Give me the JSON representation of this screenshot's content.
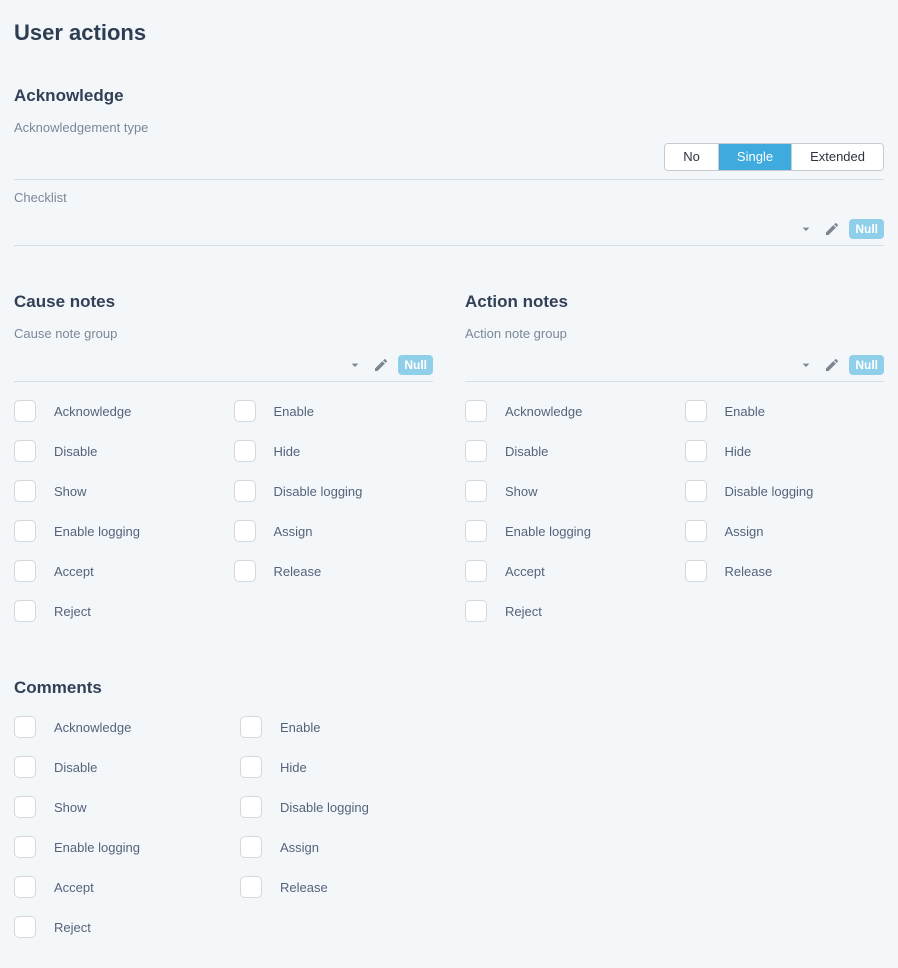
{
  "page_title": "User actions",
  "acknowledge": {
    "title": "Acknowledge",
    "type_label": "Acknowledgement type",
    "options": {
      "no": "No",
      "single": "Single",
      "extended": "Extended"
    },
    "selected": "single",
    "checklist_label": "Checklist",
    "null_badge": "Null"
  },
  "cause": {
    "title": "Cause notes",
    "group_label": "Cause note group",
    "null_badge": "Null"
  },
  "action": {
    "title": "Action notes",
    "group_label": "Action note group",
    "null_badge": "Null"
  },
  "comments": {
    "title": "Comments"
  },
  "checkbox_labels": {
    "acknowledge": "Acknowledge",
    "enable": "Enable",
    "disable": "Disable",
    "hide": "Hide",
    "show": "Show",
    "disable_logging": "Disable logging",
    "enable_logging": "Enable logging",
    "assign": "Assign",
    "accept": "Accept",
    "release": "Release",
    "reject": "Reject"
  }
}
